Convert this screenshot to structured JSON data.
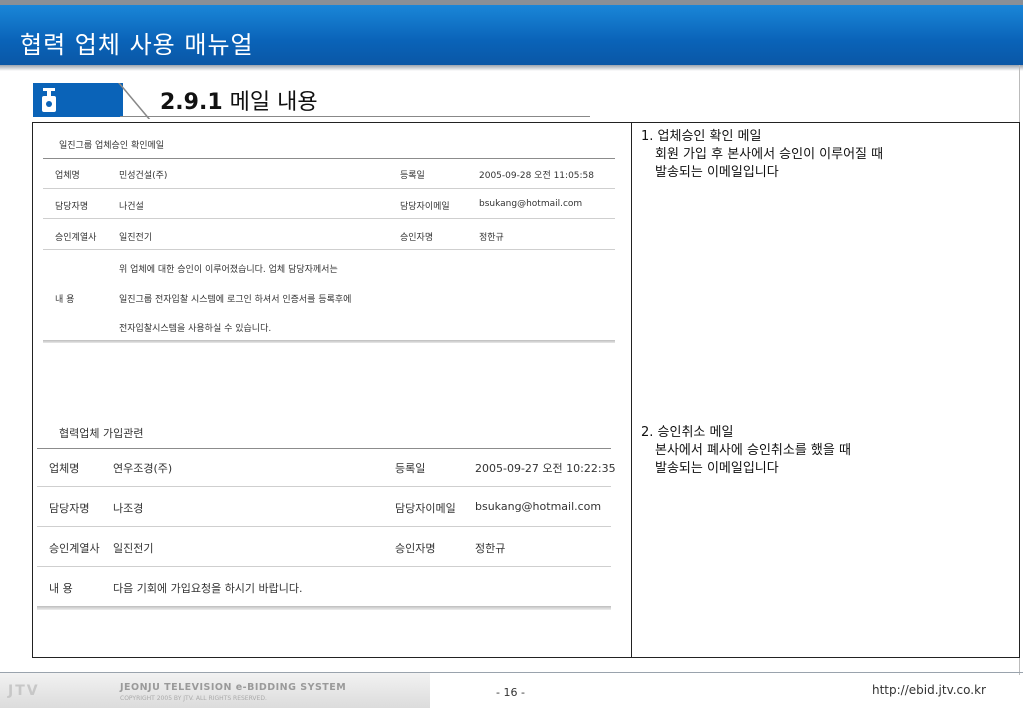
{
  "header": {
    "title": "협력 업체 사용 매뉴얼"
  },
  "section": {
    "number": "2.9.1",
    "title": "메일 내용",
    "icon": "lock-icon"
  },
  "mail_approval": {
    "title": "일진그룹 업체승인 확인메일",
    "rows": [
      {
        "label1": "업체명",
        "value1": "민성건설(주)",
        "label2": "등록일",
        "value2": "2005-09-28 오전 11:05:58"
      },
      {
        "label1": "담당자명",
        "value1": "나건설",
        "label2": "담당자이메일",
        "value2": "bsukang@hotmail.com"
      },
      {
        "label1": "승인계열사",
        "value1": "일진전기",
        "label2": "승인자명",
        "value2": "정한규"
      }
    ],
    "content_label": "내 용",
    "content_lines": [
      "위 업체에 대한 승인이 이루어졌습니다. 업체 담당자께서는",
      "일진그룹 전자입찰 시스템에 로그인 하셔서 인증서를 등록후에",
      "전자입찰시스템을 사용하실 수 있습니다."
    ]
  },
  "mail_cancel": {
    "title": "협력업체 가입관련",
    "rows": [
      {
        "label1": "업체명",
        "value1": "연우조경(주)",
        "label2": "등록일",
        "value2": "2005-09-27 오전 10:22:35"
      },
      {
        "label1": "담당자명",
        "value1": "나조경",
        "label2": "담당자이메일",
        "value2": "bsukang@hotmail.com"
      },
      {
        "label1": "승인계열사",
        "value1": "일진전기",
        "label2": "승인자명",
        "value2": "정한규"
      }
    ],
    "content_label": "내 용",
    "content_line": "다음 기회에 가입요청을 하시기 바랍니다."
  },
  "notes": [
    {
      "title": "1. 업체승인 확인 메일",
      "line1": "회원 가입 후 본사에서 승인이 이루어질 때",
      "line2": "발송되는 이메일입니다"
    },
    {
      "title": "2. 승인취소 메일",
      "line1": "본사에서 폐사에 승인취소를 했을 때",
      "line2": "발송되는 이메일입니다"
    }
  ],
  "footer": {
    "logo": "JTV",
    "system_name": "JEONJU TELEVISION e-BIDDING SYSTEM",
    "copyright": "COPYRIGHT 2005 BY JTV. ALL RIGHTS RESERVED.",
    "page": "- 16 -",
    "url": "http://ebid.jtv.co.kr"
  },
  "colors": {
    "header_blue": "#0a63b8",
    "frame": "#222222"
  }
}
